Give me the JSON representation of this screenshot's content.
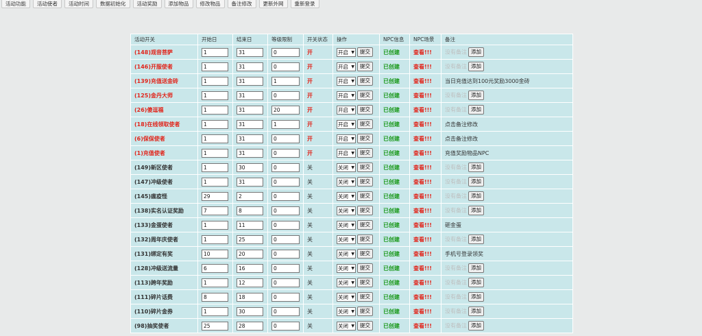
{
  "topbar": [
    "活动功能",
    "活动使者",
    "活动时间",
    "数据初始化",
    "活动奖励",
    "添加物品",
    "修改物品",
    "备注修改",
    "更新外网",
    "重新登录"
  ],
  "headers": [
    "活动开关",
    "开始日",
    "结束日",
    "等级限制",
    "开关状态",
    "操作",
    "NPC信息",
    "NPC场景",
    "备注"
  ],
  "labels": {
    "submit": "提交",
    "add": "添加",
    "placeholder": "没有备注",
    "npc_created": "已创建",
    "view": "查看!!!"
  },
  "rows": [
    {
      "name": "(148)观音菩萨",
      "start": "1",
      "end": "31",
      "level": "0",
      "state": "开",
      "op": "开启",
      "note": ""
    },
    {
      "name": "(146)开服使者",
      "start": "1",
      "end": "31",
      "level": "0",
      "state": "开",
      "op": "开启",
      "note": ""
    },
    {
      "name": "(139)充值送金砖",
      "start": "1",
      "end": "31",
      "level": "1",
      "state": "开",
      "op": "开启",
      "note": "当日充值达到100元奖励3000金砖"
    },
    {
      "name": "(125)金丹大师",
      "start": "1",
      "end": "31",
      "level": "0",
      "state": "开",
      "op": "开启",
      "note": ""
    },
    {
      "name": "(26)傻逗福",
      "start": "1",
      "end": "31",
      "level": "20",
      "state": "开",
      "op": "开启",
      "note": ""
    },
    {
      "name": "(18)在线领取使者",
      "start": "1",
      "end": "31",
      "level": "1",
      "state": "开",
      "op": "开启",
      "note": "点击备注修改"
    },
    {
      "name": "(6)保保使者",
      "start": "1",
      "end": "31",
      "level": "0",
      "state": "开",
      "op": "开启",
      "note": "点击备注修改"
    },
    {
      "name": "(1)充值使者",
      "start": "1",
      "end": "31",
      "level": "0",
      "state": "开",
      "op": "开启",
      "note": "充值奖励物品NPC"
    },
    {
      "name": "(149)新区使者",
      "start": "1",
      "end": "30",
      "level": "0",
      "state": "关",
      "op": "关闭",
      "note": ""
    },
    {
      "name": "(147)冲级使者",
      "start": "1",
      "end": "31",
      "level": "0",
      "state": "关",
      "op": "关闭",
      "note": ""
    },
    {
      "name": "(145)瘟疫怪",
      "start": "29",
      "end": "2",
      "level": "0",
      "state": "关",
      "op": "关闭",
      "note": ""
    },
    {
      "name": "(138)实名认证奖励",
      "start": "7",
      "end": "8",
      "level": "0",
      "state": "关",
      "op": "关闭",
      "note": ""
    },
    {
      "name": "(133)金蛋使者",
      "start": "1",
      "end": "11",
      "level": "0",
      "state": "关",
      "op": "关闭",
      "note": "砸金蛋"
    },
    {
      "name": "(132)周年庆使者",
      "start": "1",
      "end": "25",
      "level": "0",
      "state": "关",
      "op": "关闭",
      "note": ""
    },
    {
      "name": "(131)绑定有奖",
      "start": "10",
      "end": "20",
      "level": "0",
      "state": "关",
      "op": "关闭",
      "note": "手机号登录领奖"
    },
    {
      "name": "(128)冲级送流量",
      "start": "6",
      "end": "16",
      "level": "0",
      "state": "关",
      "op": "关闭",
      "note": ""
    },
    {
      "name": "(113)跨年奖励",
      "start": "1",
      "end": "12",
      "level": "0",
      "state": "关",
      "op": "关闭",
      "note": ""
    },
    {
      "name": "(111)碎片话费",
      "start": "8",
      "end": "18",
      "level": "0",
      "state": "关",
      "op": "关闭",
      "note": ""
    },
    {
      "name": "(110)碎片金券",
      "start": "1",
      "end": "30",
      "level": "0",
      "state": "关",
      "op": "关闭",
      "note": ""
    },
    {
      "name": "(98)抽奖使者",
      "start": "25",
      "end": "28",
      "level": "0",
      "state": "关",
      "op": "关闭",
      "note": ""
    }
  ]
}
